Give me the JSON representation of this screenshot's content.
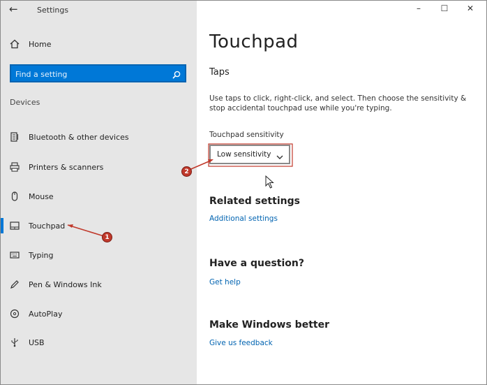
{
  "window": {
    "title": "Settings",
    "controls": {
      "minimize": "–",
      "maximize": "☐",
      "close": "✕"
    }
  },
  "sidebar": {
    "back_glyph": "←",
    "home_label": "Home",
    "search_placeholder": "Find a setting",
    "section_label": "Devices",
    "items": [
      {
        "label": "Bluetooth & other devices",
        "icon": "bluetooth-devices-icon"
      },
      {
        "label": "Printers & scanners",
        "icon": "printer-icon"
      },
      {
        "label": "Mouse",
        "icon": "mouse-icon"
      },
      {
        "label": "Touchpad",
        "icon": "touchpad-icon",
        "selected": true
      },
      {
        "label": "Typing",
        "icon": "keyboard-icon"
      },
      {
        "label": "Pen & Windows Ink",
        "icon": "pen-icon"
      },
      {
        "label": "AutoPlay",
        "icon": "autoplay-icon"
      },
      {
        "label": "USB",
        "icon": "usb-icon"
      }
    ]
  },
  "main": {
    "title": "Touchpad",
    "taps": {
      "heading": "Taps",
      "description": "Use taps to click, right-click, and select. Then choose the sensitivity & stop accidental touchpad use while you're typing.",
      "sensitivity_label": "Touchpad sensitivity",
      "sensitivity_value": "Low sensitivity"
    },
    "related": {
      "heading": "Related settings",
      "link": "Additional settings"
    },
    "question": {
      "heading": "Have a question?",
      "link": "Get help"
    },
    "feedback": {
      "heading": "Make Windows better",
      "link": "Give us feedback"
    }
  },
  "annotations": {
    "callout_1": "1",
    "callout_2": "2",
    "color": "#c0392b"
  },
  "colors": {
    "accent": "#0078d7",
    "sidebar_bg": "#e6e6e6",
    "link": "#0063b1"
  }
}
